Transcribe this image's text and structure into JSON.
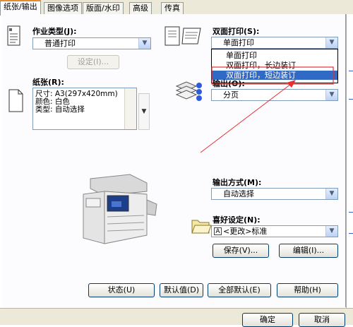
{
  "tabs": [
    {
      "label": "纸张/输出",
      "active": true
    },
    {
      "label": "图像选项",
      "active": false
    },
    {
      "label": "版面/水印",
      "active": false
    },
    {
      "label": "高级",
      "active": false
    },
    {
      "label": "传真",
      "active": false
    }
  ],
  "job_type": {
    "label": "作业类型(J):",
    "value": "普通打印",
    "settings_button": "设定(I)..."
  },
  "paper": {
    "label": "纸张(R):",
    "size": "尺寸: A3(297x420mm)",
    "color": "颜色: 白色",
    "type": "类型: 自动选择"
  },
  "duplex": {
    "label": "双面打印(S):",
    "value": "单面打印",
    "options": [
      "单面打印",
      "双面打印，长边装订",
      "双面打印，短边装订"
    ],
    "highlighted_index": 2
  },
  "collate": {
    "label": "输出(O):",
    "value": "分页"
  },
  "output_method": {
    "label": "输出方式(M):",
    "value": "自动选择"
  },
  "favorites": {
    "label": "喜好设定(N):",
    "value": "<更改>标准",
    "badge": "A",
    "save_button": "保存(V)...",
    "edit_button": "编辑(I)..."
  },
  "footer_buttons": {
    "status": "状态(U)",
    "defaults": "默认值(D)",
    "all_defaults": "全部默认(E)",
    "help": "帮助(H)"
  },
  "dialog_buttons": {
    "ok": "确定",
    "cancel": "取消"
  },
  "annotation_color": "#e83030",
  "selection_color": "#316ac5"
}
